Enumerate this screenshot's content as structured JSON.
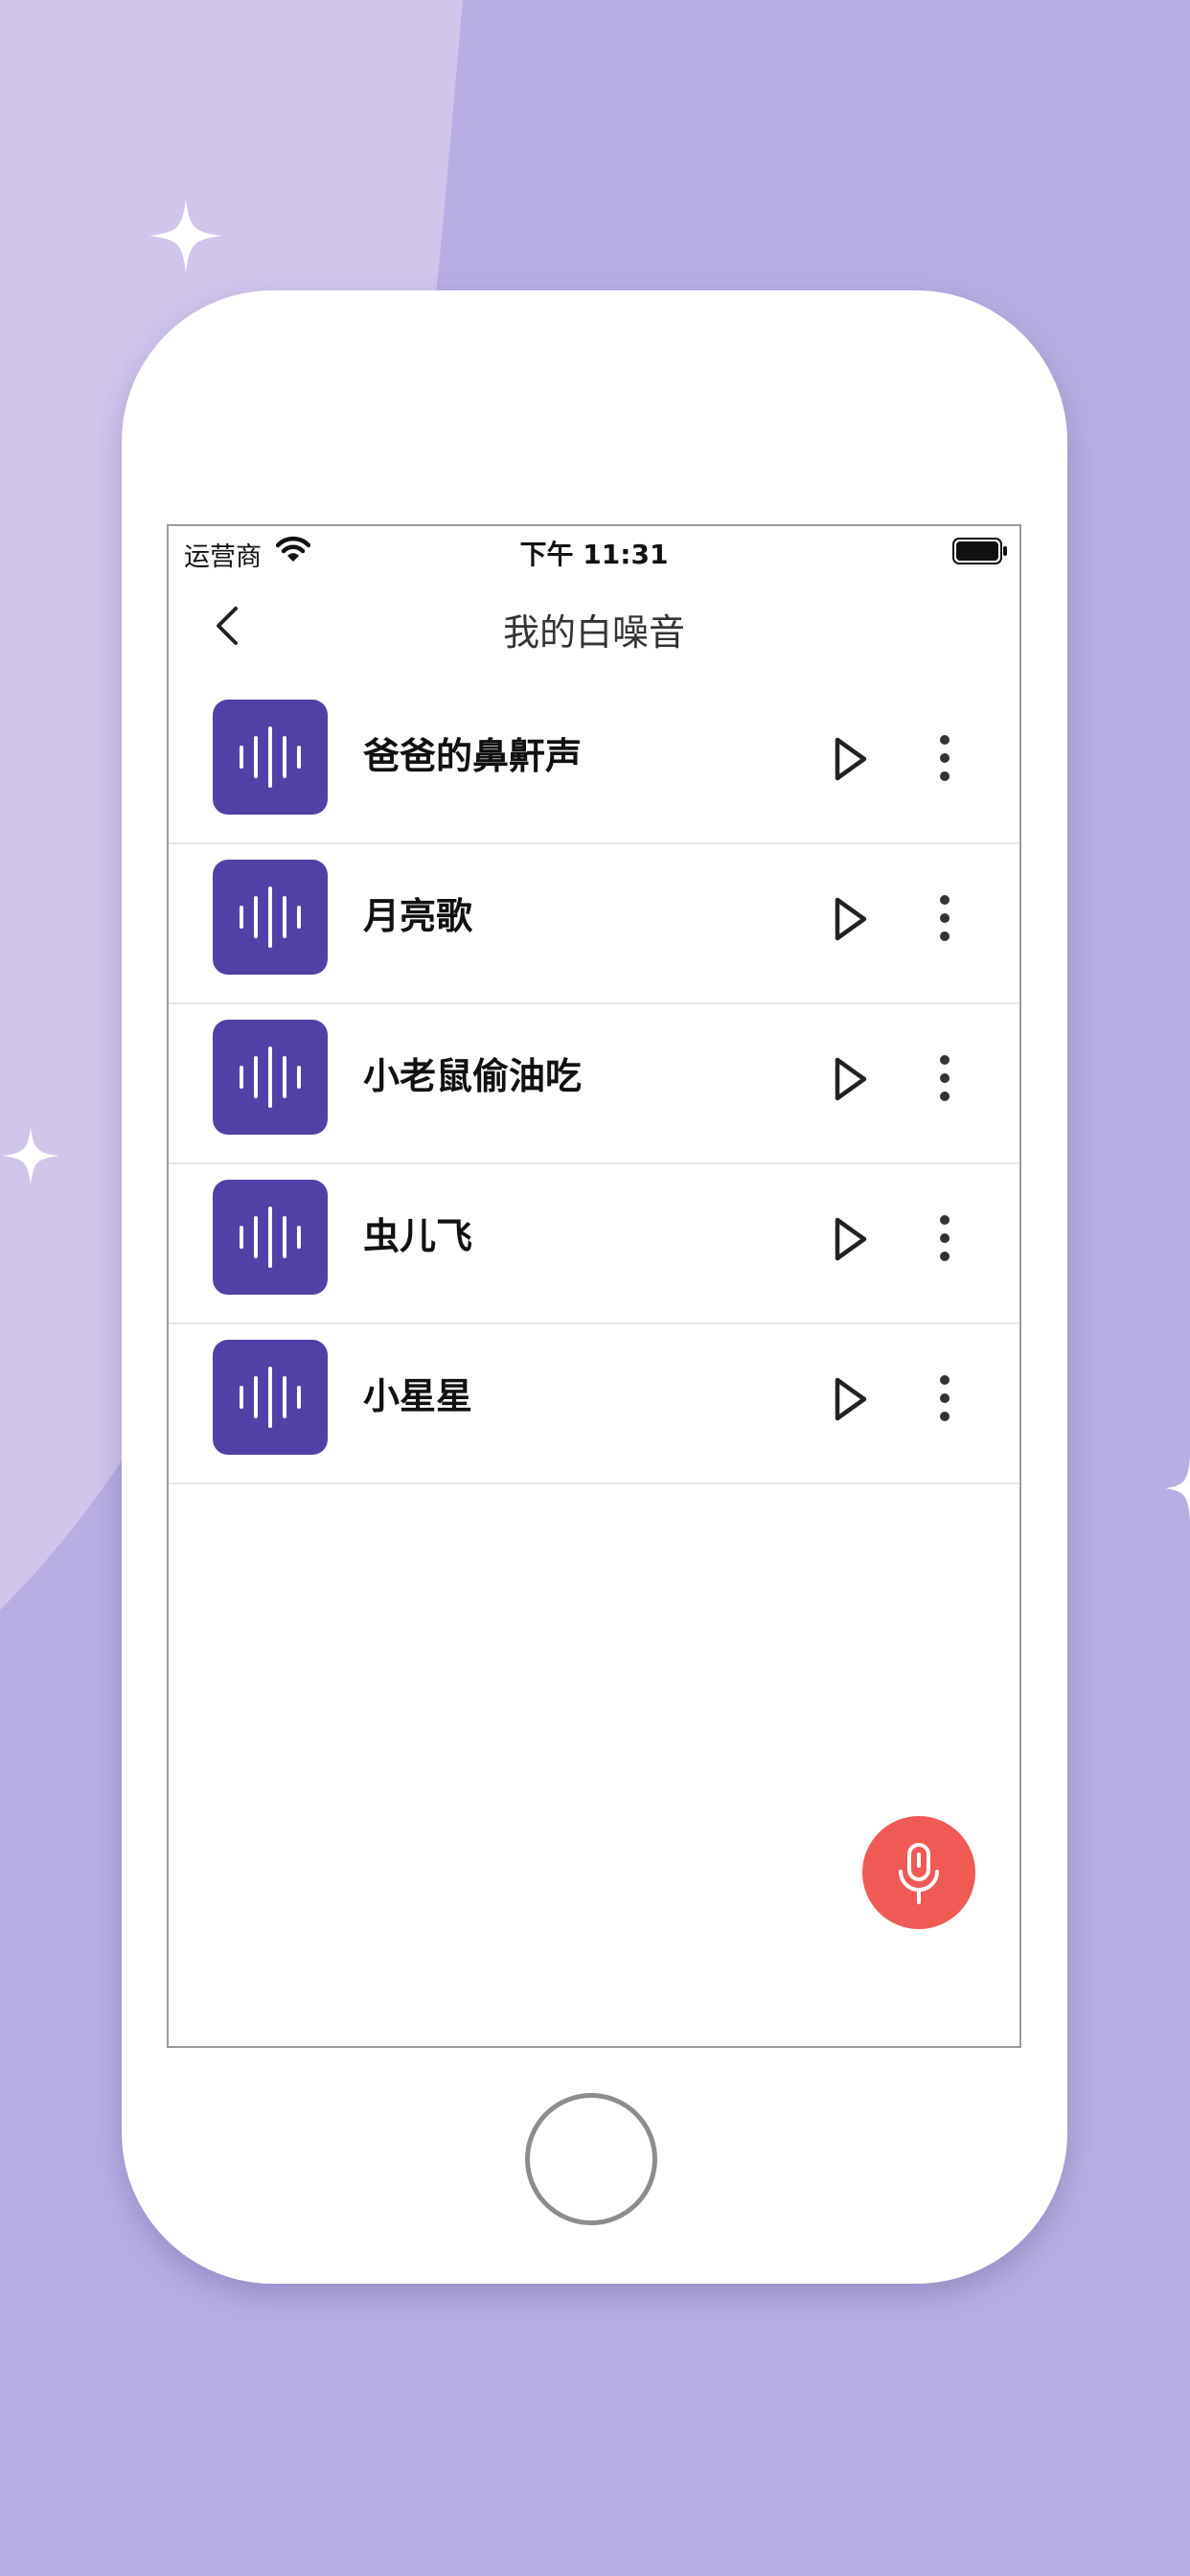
{
  "colors": {
    "background": "#b8aee2",
    "background_light": "#d0c6ea",
    "thumb": "#5240a6",
    "fab": "#f05a55"
  },
  "status_bar": {
    "carrier": "运营商",
    "time": "下午 11:31",
    "icons": [
      "wifi-icon",
      "battery-icon"
    ]
  },
  "nav": {
    "title": "我的白噪音",
    "back_icon": "chevron-left-icon"
  },
  "items": [
    {
      "label": "爸爸的鼻鼾声",
      "thumb_icon": "sound-wave-icon",
      "play_icon": "play-icon",
      "more_icon": "more-vertical-icon"
    },
    {
      "label": "月亮歌",
      "thumb_icon": "sound-wave-icon",
      "play_icon": "play-icon",
      "more_icon": "more-vertical-icon"
    },
    {
      "label": "小老鼠偷油吃",
      "thumb_icon": "sound-wave-icon",
      "play_icon": "play-icon",
      "more_icon": "more-vertical-icon"
    },
    {
      "label": "虫儿飞",
      "thumb_icon": "sound-wave-icon",
      "play_icon": "play-icon",
      "more_icon": "more-vertical-icon"
    },
    {
      "label": "小星星",
      "thumb_icon": "sound-wave-icon",
      "play_icon": "play-icon",
      "more_icon": "more-vertical-icon"
    }
  ],
  "fab": {
    "icon": "microphone-icon"
  },
  "home_button": {
    "icon": "home-button-circle"
  }
}
